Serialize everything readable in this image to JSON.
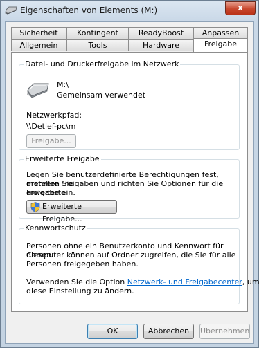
{
  "window": {
    "title": "Eigenschaften von Elements (M:)",
    "close_label": "x"
  },
  "tabs_top": [
    "Sicherheit",
    "Kontingent",
    "ReadyBoost",
    "Anpassen"
  ],
  "tabs_bottom": [
    "Allgemein",
    "Tools",
    "Hardware",
    "Freigabe"
  ],
  "active_tab": "Freigabe",
  "sharing": {
    "group_title": "Datei- und Druckerfreigabe im Netzwerk",
    "drive_name": "M:\\",
    "drive_status": "Gemeinsam verwendet",
    "path_label": "Netzwerkpfad:",
    "path_value": "\\\\Detlef-pc\\m",
    "share_button": "Freigabe..."
  },
  "advanced": {
    "group_title": "Erweiterte Freigabe",
    "description_line1": "Legen Sie benutzerdefinierte Berechtigungen fest, erstellen Sie",
    "description_line2": "mehrere Freigaben und richten Sie Optionen für die erweiterte",
    "description_line3": "Freigabe ein.",
    "button": "Erweiterte Freigabe..."
  },
  "password": {
    "group_title": "Kennwortschutz",
    "line1": "Personen ohne ein Benutzerkonto und Kennwort für diesen",
    "line2": "Computer können auf Ordner zugreifen, die Sie für alle",
    "line3": "Personen freigegeben haben.",
    "line4_pre": "Verwenden Sie die Option ",
    "line4_link": "Netzwerk- und Freigabecenter",
    "line4_post": ", um",
    "line5": "diese Einstellung zu ändern."
  },
  "buttons": {
    "ok": "OK",
    "cancel": "Abbrechen",
    "apply": "Übernehmen"
  }
}
